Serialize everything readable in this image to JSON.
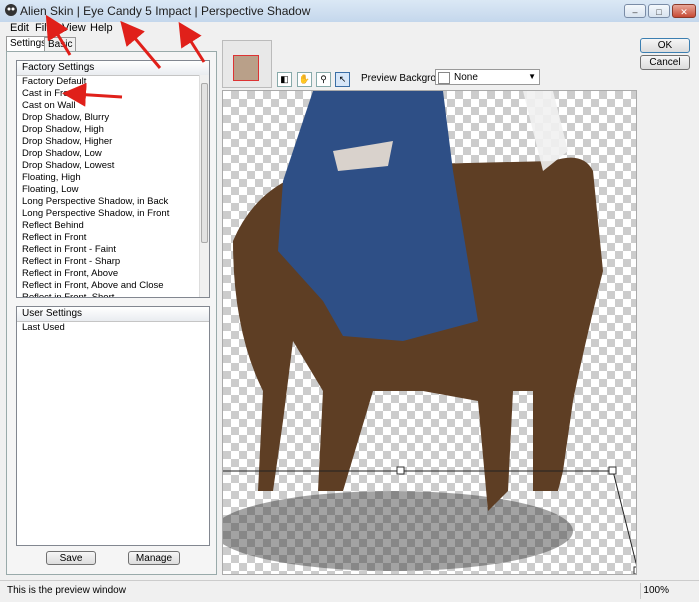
{
  "window": {
    "title": "Alien Skin | Eye Candy 5 Impact | Perspective Shadow"
  },
  "menu": {
    "items": [
      "Edit",
      "Filter",
      "View",
      "Help"
    ]
  },
  "tabs": {
    "settings": "Settings",
    "basic": "Basic"
  },
  "factory": {
    "header": "Factory Settings",
    "items": [
      "Factory Default",
      "Cast in Front",
      "Cast on Wall",
      "Drop Shadow, Blurry",
      "Drop Shadow, High",
      "Drop Shadow, Higher",
      "Drop Shadow, Low",
      "Drop Shadow, Lowest",
      "Floating, High",
      "Floating, Low",
      "Long Perspective Shadow, in Back",
      "Long Perspective Shadow, in Front",
      "Reflect Behind",
      "Reflect in Front",
      "Reflect in Front - Faint",
      "Reflect in Front - Sharp",
      "Reflect in Front, Above",
      "Reflect in Front, Above and Close",
      "Reflect in Front, Short"
    ]
  },
  "user": {
    "header": "User Settings",
    "items": [
      "Last Used"
    ]
  },
  "buttons": {
    "save": "Save",
    "manage": "Manage",
    "ok": "OK",
    "cancel": "Cancel"
  },
  "preview_bg": {
    "label": "Preview Background:",
    "value": "None"
  },
  "status": {
    "message": "This is the preview window",
    "zoom": "100%"
  },
  "colors": {
    "annotation_arrow": "#e0201a",
    "dress": "#2e4f86",
    "horse": "#5a3a22"
  }
}
